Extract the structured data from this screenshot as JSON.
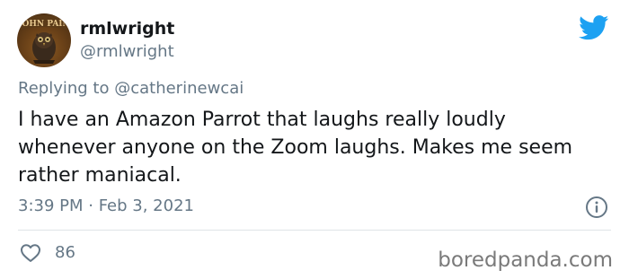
{
  "author": {
    "display_name": "rmlwright",
    "handle": "@rmlwright",
    "avatar_text": "JOHN PAIN"
  },
  "reply": {
    "prefix": "Replying to",
    "target": "@catherinewcai"
  },
  "tweet": {
    "text": "I have an Amazon Parrot that laughs really loudly whenever anyone on the Zoom laughs. Makes me seem rather maniacal.",
    "timestamp": "3:39 PM · Feb 3, 2021",
    "likes": "86"
  },
  "watermark": "boredpanda.com",
  "icons": {
    "brand": "twitter-bird-icon",
    "info": "info-icon",
    "like": "heart-icon"
  },
  "colors": {
    "twitter_blue": "#1da1f2",
    "secondary_text": "#657786"
  }
}
